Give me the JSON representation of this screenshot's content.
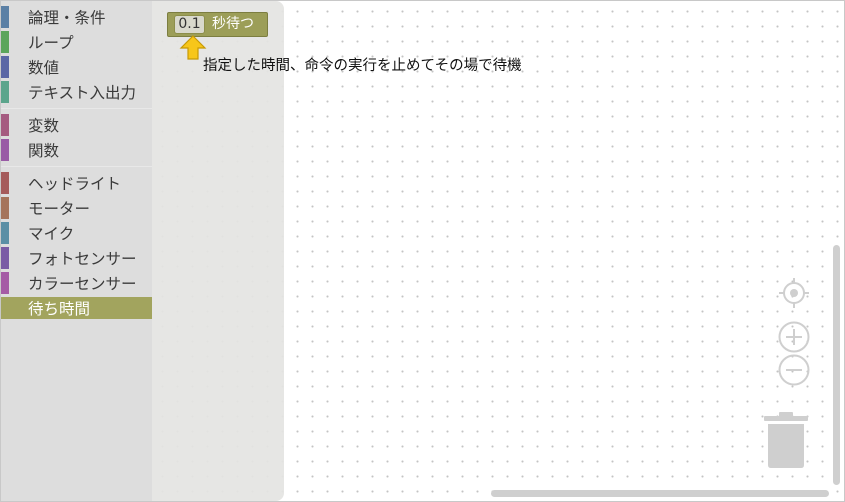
{
  "toolbox": {
    "categories": [
      {
        "label": "論理・条件",
        "color": "#5b80a5"
      },
      {
        "label": "ループ",
        "color": "#5ba55b"
      },
      {
        "label": "数値",
        "color": "#5b67a5"
      },
      {
        "label": "テキスト入出力",
        "color": "#5ba58c"
      },
      {
        "label": "変数",
        "color": "#a55b80"
      },
      {
        "label": "関数",
        "color": "#995ba5"
      },
      {
        "label": "ヘッドライト",
        "color": "#a55b5b"
      },
      {
        "label": "モーター",
        "color": "#a5745b"
      },
      {
        "label": "マイク",
        "color": "#5b8fa5"
      },
      {
        "label": "フォトセンサー",
        "color": "#7a5ba5"
      },
      {
        "label": "カラーセンサー",
        "color": "#a55ba5"
      },
      {
        "label": "待ち時間",
        "color": "#a2a45e",
        "selected": true
      }
    ]
  },
  "flyout": {
    "block": {
      "value": "0.1",
      "label": "秒待つ",
      "color": "#9c9e58"
    }
  },
  "tooltip": {
    "description": "指定した時間、命令の実行を止めてその場で待機"
  },
  "controls": {
    "recenter_icon": "target-icon",
    "zoom_in_icon": "plus-circle-icon",
    "zoom_out_icon": "minus-circle-icon",
    "trash_icon": "trash-icon"
  }
}
